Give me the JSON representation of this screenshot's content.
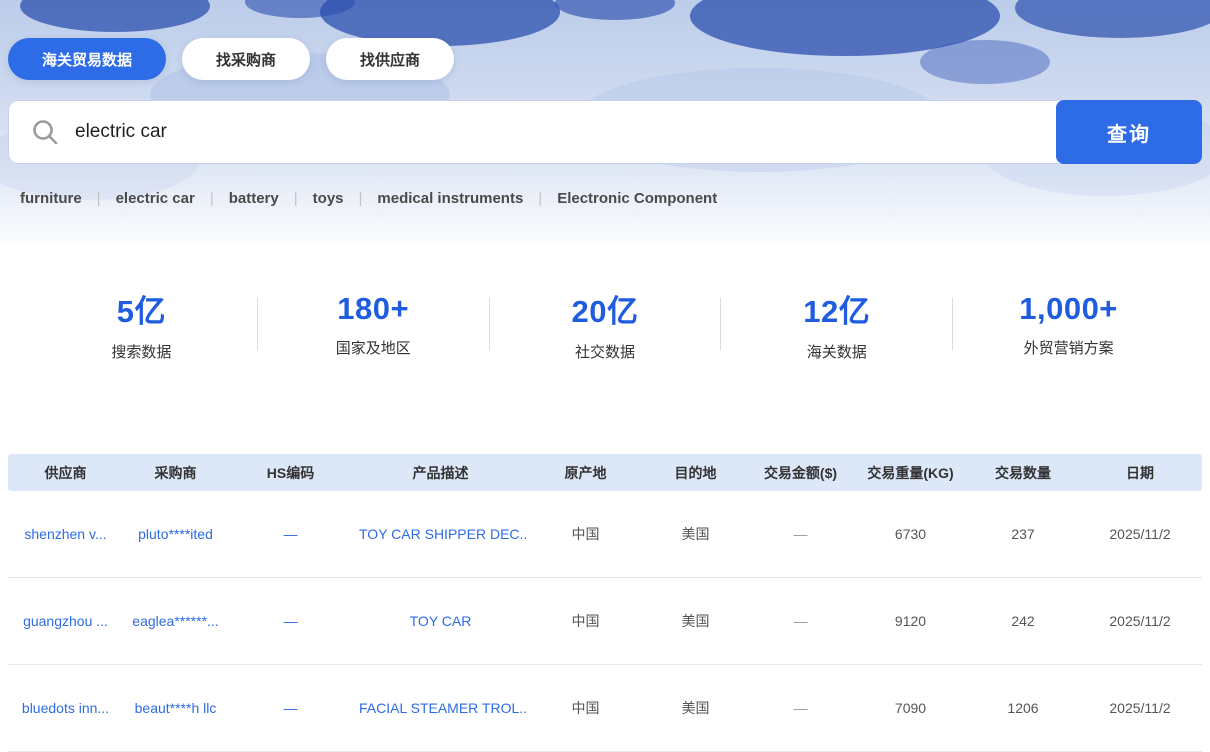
{
  "colors": {
    "accent": "#2e6be6",
    "stat_blue": "#1f5ce0",
    "table_header_bg": "#dce8f8"
  },
  "tabs": [
    {
      "label": "海关贸易数据",
      "active": true
    },
    {
      "label": "找采购商",
      "active": false
    },
    {
      "label": "找供应商",
      "active": false
    }
  ],
  "search": {
    "value": "electric car",
    "button_label": "查询"
  },
  "hot_keywords": [
    "furniture",
    "electric car",
    "battery",
    "toys",
    "medical instruments",
    "Electronic Component"
  ],
  "stats": [
    {
      "value": "5亿",
      "label": "搜索数据"
    },
    {
      "value": "180+",
      "label": "国家及地区"
    },
    {
      "value": "20亿",
      "label": "社交数据"
    },
    {
      "value": "12亿",
      "label": "海关数据"
    },
    {
      "value": "1,000+",
      "label": "外贸营销方案"
    }
  ],
  "table": {
    "columns": [
      "供应商",
      "采购商",
      "HS编码",
      "产品描述",
      "原产地",
      "目的地",
      "交易金额($)",
      "交易重量(KG)",
      "交易数量",
      "日期"
    ],
    "rows": [
      {
        "supplier": "shenzhen v...",
        "buyer": "pluto****ited",
        "hs_code": "—",
        "product": "TOY CAR SHIPPER DEC...",
        "origin": "中国",
        "destination": "美国",
        "amount": "—",
        "weight": "6730",
        "quantity": "237",
        "date": "2025/11/2"
      },
      {
        "supplier": "guangzhou ...",
        "buyer": "eaglea******...",
        "hs_code": "—",
        "product": "TOY CAR",
        "origin": "中国",
        "destination": "美国",
        "amount": "—",
        "weight": "9120",
        "quantity": "242",
        "date": "2025/11/2"
      },
      {
        "supplier": "bluedots inn...",
        "buyer": "beaut****h llc",
        "hs_code": "—",
        "product": "FACIAL STEAMER TROL...",
        "origin": "中国",
        "destination": "美国",
        "amount": "—",
        "weight": "7090",
        "quantity": "1206",
        "date": "2025/11/2"
      }
    ]
  }
}
